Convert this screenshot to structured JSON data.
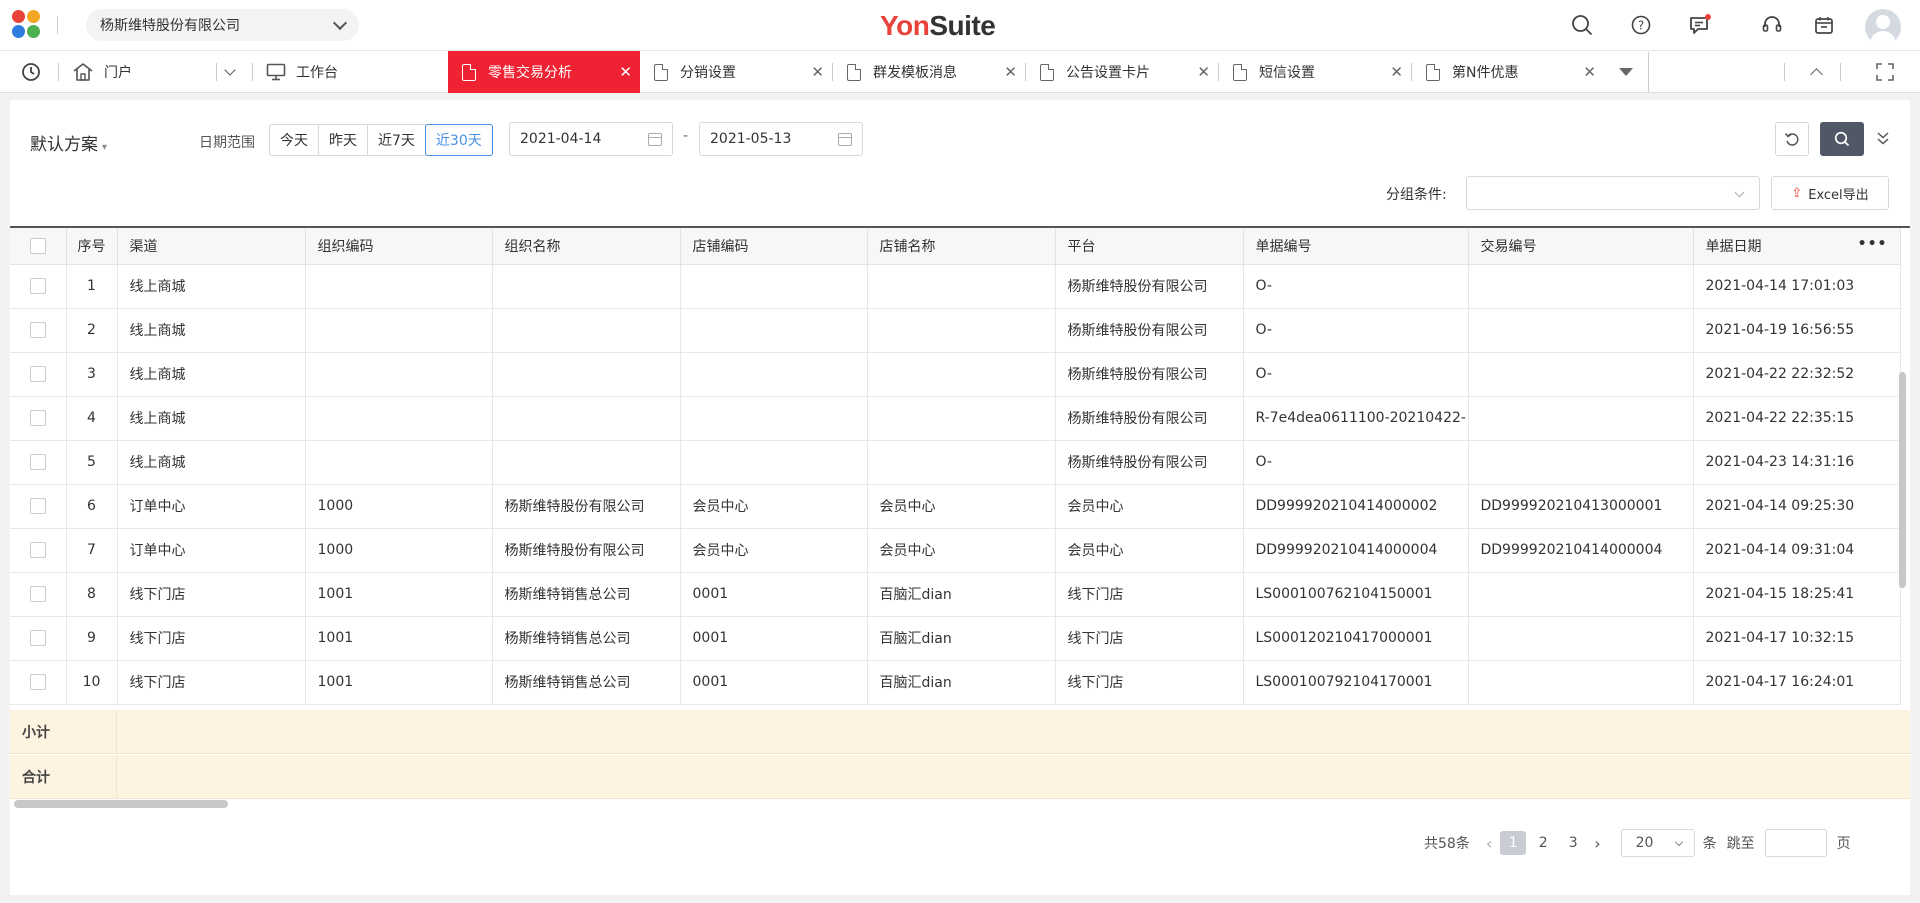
{
  "header": {
    "org_name": "杨斯维特股份有限公司",
    "brand_part1": "Yon",
    "brand_part2": "Suite"
  },
  "tabs": [
    {
      "label": "门户"
    },
    {
      "label": "工作台"
    },
    {
      "label": "零售交易分析",
      "active": true
    },
    {
      "label": "分销设置"
    },
    {
      "label": "群发模板消息"
    },
    {
      "label": "公告设置卡片"
    },
    {
      "label": "短信设置"
    },
    {
      "label": "第N件优惠"
    }
  ],
  "toolbar": {
    "scheme_label": "默认方案",
    "date_range_label": "日期范围",
    "range_options": [
      "今天",
      "昨天",
      "近7天",
      "近30天"
    ],
    "selected_range": "近30天",
    "start_date": "2021-04-14",
    "end_date": "2021-05-13",
    "date_separator": "-",
    "group_label": "分组条件:",
    "group_value": "",
    "excel_label": "Excel导出"
  },
  "table": {
    "columns": [
      "序号",
      "渠道",
      "组织编码",
      "组织名称",
      "店铺编码",
      "店铺名称",
      "平台",
      "单据编号",
      "交易编号",
      "单据日期"
    ],
    "rows": [
      [
        "1",
        "线上商城",
        "",
        "",
        "",
        "",
        "杨斯维特股份有限公司",
        "O-",
        "",
        "2021-04-14 17:01:03"
      ],
      [
        "2",
        "线上商城",
        "",
        "",
        "",
        "",
        "杨斯维特股份有限公司",
        "O-",
        "",
        "2021-04-19 16:56:55"
      ],
      [
        "3",
        "线上商城",
        "",
        "",
        "",
        "",
        "杨斯维特股份有限公司",
        "O-",
        "",
        "2021-04-22 22:32:52"
      ],
      [
        "4",
        "线上商城",
        "",
        "",
        "",
        "",
        "杨斯维特股份有限公司",
        "R-7e4dea0611100-20210422-",
        "",
        "2021-04-22 22:35:15"
      ],
      [
        "5",
        "线上商城",
        "",
        "",
        "",
        "",
        "杨斯维特股份有限公司",
        "O-",
        "",
        "2021-04-23 14:31:16"
      ],
      [
        "6",
        "订单中心",
        "1000",
        "杨斯维特股份有限公司",
        "会员中心",
        "会员中心",
        "会员中心",
        "DD999920210414000002",
        "DD999920210413000001",
        "2021-04-14 09:25:30"
      ],
      [
        "7",
        "订单中心",
        "1000",
        "杨斯维特股份有限公司",
        "会员中心",
        "会员中心",
        "会员中心",
        "DD999920210414000004",
        "DD999920210414000004",
        "2021-04-14 09:31:04"
      ],
      [
        "8",
        "线下门店",
        "1001",
        "杨斯维特销售总公司",
        "0001",
        "百脑汇dian",
        "线下门店",
        "LS000100762104150001",
        "",
        "2021-04-15 18:25:41"
      ],
      [
        "9",
        "线下门店",
        "1001",
        "杨斯维特销售总公司",
        "0001",
        "百脑汇dian",
        "线下门店",
        "LS000120210417000001",
        "",
        "2021-04-17 10:32:15"
      ],
      [
        "10",
        "线下门店",
        "1001",
        "杨斯维特销售总公司",
        "0001",
        "百脑汇dian",
        "线下门店",
        "LS000100792104170001",
        "",
        "2021-04-17 16:24:01"
      ]
    ],
    "subtotal_label": "小计",
    "total_label": "合计"
  },
  "pagination": {
    "total_text": "共58条",
    "pages": [
      "1",
      "2",
      "3"
    ],
    "current_page": "1",
    "page_size": "20",
    "size_unit": "条",
    "jump_label": "跳至",
    "page_unit": "页"
  },
  "colors": {
    "brand_red": "#e8423a",
    "active_tab": "#ee2233",
    "accent_blue": "#4a90e2",
    "summary_bg": "#fcf3e1"
  }
}
